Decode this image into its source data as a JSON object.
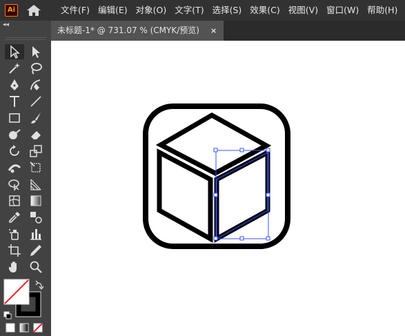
{
  "app": {
    "logo_text": "Ai"
  },
  "menu": {
    "items": [
      "文件(F)",
      "编辑(E)",
      "对象(O)",
      "文字(T)",
      "选择(S)",
      "效果(C)",
      "视图(V)",
      "窗口(W)",
      "帮助(H)"
    ]
  },
  "tab": {
    "title": "未标题-1* @ 731.07 % (CMYK/预览)",
    "close": "×"
  },
  "toolbar": {
    "collapse": "◂◂"
  },
  "colors": {
    "accent": "#ff7c00",
    "selection": "#3355ff",
    "panel": "#424242",
    "menubar": "#323232"
  },
  "tools": [
    "selection-tool",
    "direct-selection-tool",
    "magic-wand-tool",
    "lasso-tool",
    "pen-tool",
    "curvature-tool",
    "type-tool",
    "line-segment-tool",
    "rectangle-tool",
    "paintbrush-tool",
    "shaper-tool",
    "eraser-tool",
    "rotate-tool",
    "scale-tool",
    "width-tool",
    "free-transform-tool",
    "shape-builder-tool",
    "perspective-grid-tool",
    "mesh-tool",
    "gradient-tool",
    "eyedropper-tool",
    "blend-tool",
    "symbol-sprayer-tool",
    "column-graph-tool",
    "artboard-tool",
    "slice-tool",
    "hand-tool",
    "zoom-tool"
  ]
}
